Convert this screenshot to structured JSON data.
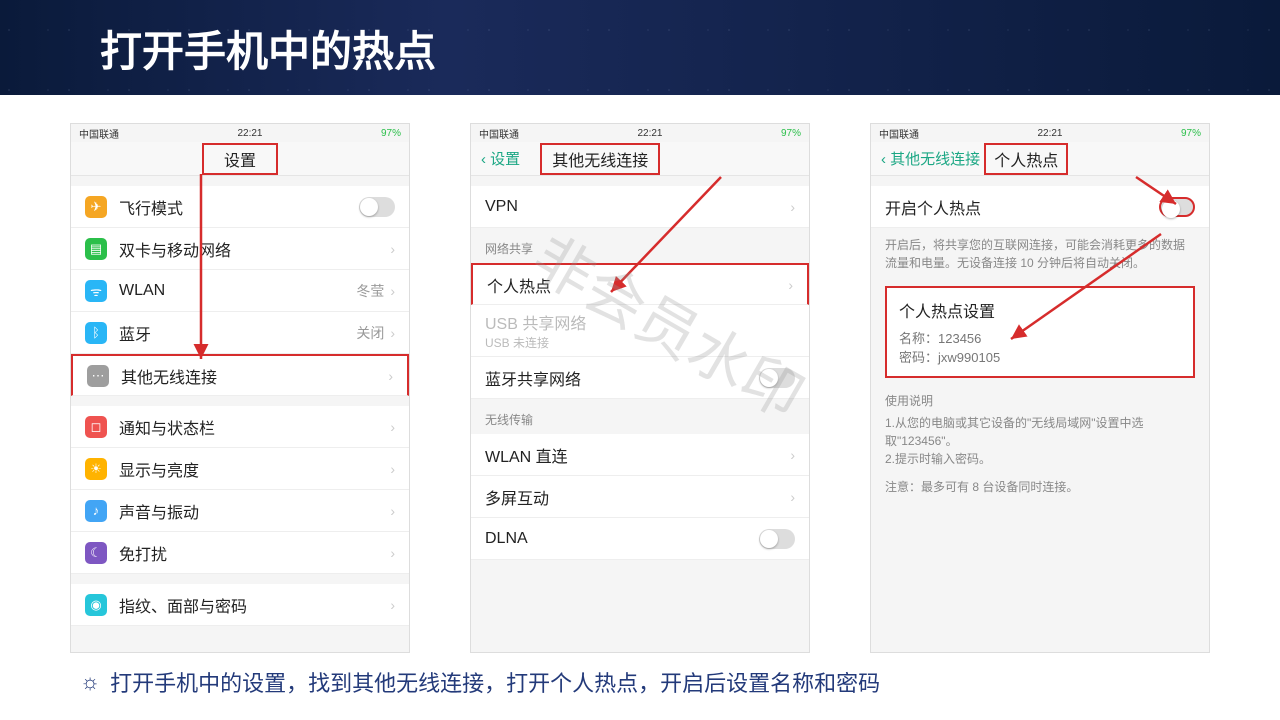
{
  "slide": {
    "title": "打开手机中的热点",
    "footer": "打开手机中的设置，找到其他无线连接，打开个人热点，开启后设置名称和密码"
  },
  "watermark": "非会员水印",
  "status": {
    "carrier": "中国联通",
    "time": "22:21",
    "battery": "97%"
  },
  "phone1": {
    "title": "设置",
    "rows": {
      "airplane": "飞行模式",
      "dualsim": "双卡与移动网络",
      "wlan": "WLAN",
      "wlan_val": "冬莹",
      "bluetooth": "蓝牙",
      "bt_val": "关闭",
      "other": "其他无线连接",
      "notif": "通知与状态栏",
      "display": "显示与亮度",
      "sound": "声音与振动",
      "dnd": "免打扰",
      "fingerprint": "指纹、面部与密码"
    }
  },
  "phone2": {
    "back": "设置",
    "title": "其他无线连接",
    "rows": {
      "vpn": "VPN",
      "sect_share": "网络共享",
      "hotspot": "个人热点",
      "usb": "USB 共享网络",
      "usb_sub": "USB 未连接",
      "bt_share": "蓝牙共享网络",
      "sect_wireless": "无线传输",
      "wlan_direct": "WLAN 直连",
      "multiscreen": "多屏互动",
      "dlna": "DLNA"
    }
  },
  "phone3": {
    "back": "其他无线连接",
    "title": "个人热点",
    "enable": "开启个人热点",
    "enable_desc": "开启后，将共享您的互联网连接，可能会消耗更多的数据流量和电量。无设备连接 10 分钟后将自动关闭。",
    "settings_title": "个人热点设置",
    "name_label": "名称：",
    "name_val": "123456",
    "pwd_label": "密码：",
    "pwd_val": "jxw990105",
    "instr_title": "使用说明",
    "instr1": "1.从您的电脑或其它设备的\"无线局域网\"设置中选取\"123456\"。",
    "instr2": "2.提示时输入密码。",
    "note": "注意：最多可有 8 台设备同时连接。"
  }
}
